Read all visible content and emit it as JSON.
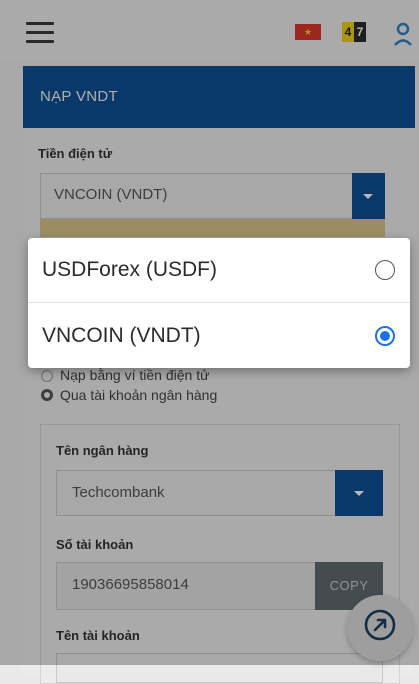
{
  "topbar": {
    "menu_icon": "hamburger-menu-icon",
    "language_flag": "vietnam-flag-icon",
    "badge_icon": "47-badge-icon",
    "user_icon": "user-avatar-icon"
  },
  "card": {
    "title": "NẠP VNDT"
  },
  "crypto": {
    "label": "Tiền điện tử",
    "selected": "VNCOIN (VNDT)"
  },
  "method": {
    "option1": "Nạp bằng ví tiền điện tử",
    "option2": "Qua tài khoản ngân hàng",
    "selected_index": 1
  },
  "bank": {
    "name_label": "Tên ngân hàng",
    "name_value": "Techcombank",
    "account_no_label": "Số tài khoản",
    "account_no_value": "19036695858014",
    "copy_label": "COPY",
    "account_name_label": "Tên tài khoản"
  },
  "dropdown": {
    "options": [
      {
        "label": "USDForex (USDF)",
        "selected": false
      },
      {
        "label": "VNCOIN (VNDT)",
        "selected": true
      }
    ]
  },
  "colors": {
    "primary": "#0d4f94",
    "radio_selected": "#1a73e8"
  }
}
